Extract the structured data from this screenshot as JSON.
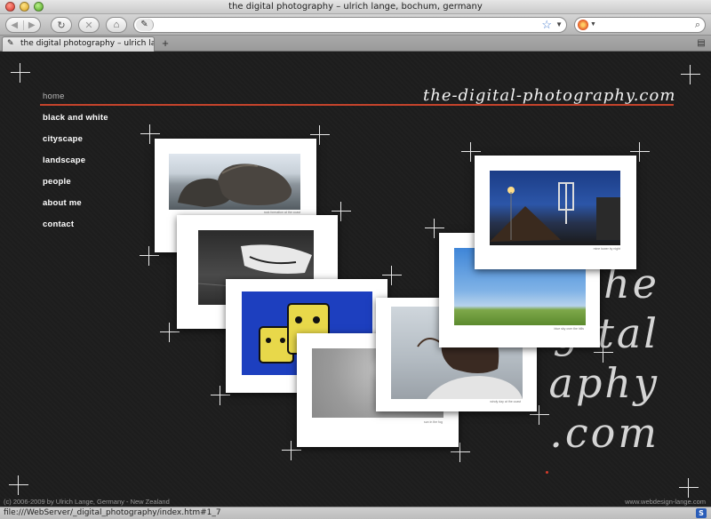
{
  "window": {
    "title": "the digital photography – ulrich lange, bochum, germany"
  },
  "toolbar": {
    "back_icon": "◀",
    "forward_icon": "▶",
    "reload_icon": "↻",
    "stop_icon": "✕",
    "home_icon": "⌂",
    "url_value": "",
    "search_value": ""
  },
  "tab": {
    "label": "the digital photography – ulrich lange, bochum, germany",
    "new_tab_label": "+"
  },
  "site": {
    "logo": "the-digital-photography.com",
    "nav": [
      {
        "label": "home"
      },
      {
        "label": "black and white"
      },
      {
        "label": "cityscape"
      },
      {
        "label": "landscape"
      },
      {
        "label": "people"
      },
      {
        "label": "about me"
      },
      {
        "label": "contact"
      }
    ],
    "big_text": [
      "he",
      "gital",
      "aphy",
      ".com"
    ],
    "footer_left": "(c) 2006-2009 by Ulrich Lange, Germany - New Zealand",
    "footer_right": "www.webdesign-lange.com"
  },
  "photos": [
    {
      "subject": "rocks-by-the-sea",
      "caption": "rock formation at the coast"
    },
    {
      "subject": "rowing-boat",
      "caption": "boat on the beach"
    },
    {
      "subject": "yellow-graffiti-faces",
      "caption": "yellow graffiti"
    },
    {
      "subject": "sun-in-fog",
      "caption": "sun in the fog"
    },
    {
      "subject": "woman-hair-in-wind",
      "caption": "windy day at the coast"
    },
    {
      "subject": "blue-sky-landscape",
      "caption": "blue sky over the hills"
    },
    {
      "subject": "mine-tower-at-night",
      "caption": "mine tower by night"
    }
  ],
  "status": {
    "text": "file:///WebServer/_digital_photography/index.htm#1_7"
  }
}
